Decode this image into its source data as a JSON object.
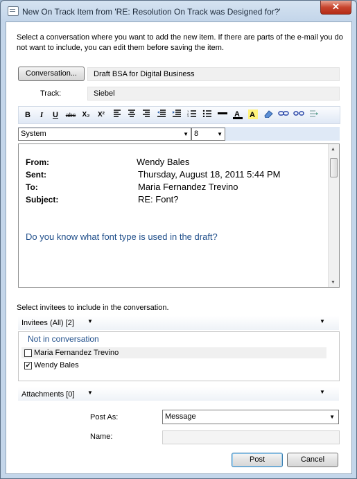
{
  "window": {
    "title": "New On Track Item from 'RE: Resolution On Track was Designed for?'",
    "close_glyph": "✕"
  },
  "intro": "Select a conversation where you want to add the new item. If there are parts of the e-mail you do not want to include, you can edit them before saving the item.",
  "conversation": {
    "button_label": "Conversation...",
    "value": "Draft BSA for Digital Business"
  },
  "track": {
    "label": "Track:",
    "value": "Siebel"
  },
  "toolbar": {
    "bold": "B",
    "italic": "I",
    "underline": "U",
    "strike": "abc",
    "subscript": "X₂",
    "superscript": "X²"
  },
  "font": {
    "family": "System",
    "size": "8"
  },
  "message": {
    "from_label": "From:",
    "from_value": "Wendy Bales",
    "sent_label": "Sent:",
    "sent_value": "Thursday, August 18, 2011 5:44 PM",
    "to_label": "To:",
    "to_value": "Maria Fernandez Trevino",
    "subject_label": "Subject:",
    "subject_value": "RE: Font?",
    "body": "Do you know what font type is used in the draft?"
  },
  "invitees": {
    "prompt": "Select invitees to include in the conversation.",
    "header": "Invitees (All) [2]",
    "group_label": "Not in conversation",
    "people": [
      {
        "name": "Maria Fernandez Trevino",
        "checked": false
      },
      {
        "name": "Wendy Bales",
        "checked": true
      }
    ]
  },
  "attachments": {
    "header": "Attachments [0]"
  },
  "post_as": {
    "label": "Post As:",
    "value": "Message"
  },
  "name": {
    "label": "Name:",
    "value": ""
  },
  "buttons": {
    "post": "Post",
    "cancel": "Cancel"
  },
  "colors": {
    "body_text": "#1f4e8a",
    "group_label": "#1f4e8a",
    "close": "#c8452e"
  }
}
